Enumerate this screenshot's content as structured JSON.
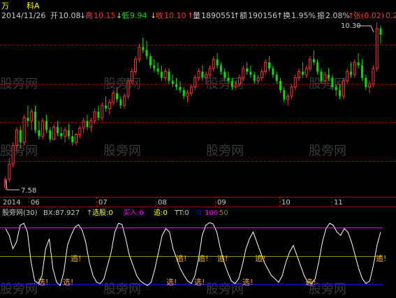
{
  "header": {
    "title": "万",
    "stock_name": "科A",
    "date": "2014/11/26",
    "open_label": "开",
    "open_value": "10.08",
    "high_label": "高",
    "high_value": "10.15",
    "low_label": "低",
    "low_value": "9.94",
    "close_label": "收",
    "close_value": "10.10",
    "volume_label": "量",
    "volume_value": "1890551",
    "amount_label": "额",
    "amount_value": "190156",
    "turnover_label": "换",
    "turnover_value": "1.95%",
    "amplitude_label": "振",
    "amplitude_value": "2.08%",
    "change_label": "张",
    "change_value": "(0.02)",
    "change_pct_value": "0.2"
  },
  "colors": {
    "background": "#000000",
    "up": "#ff3232",
    "down": "#00e000",
    "grid": "#a00000",
    "text": "#c8c8c8",
    "yellow": "#ffff00",
    "magenta": "#ff00ff",
    "indicator_line": "#ffffff",
    "upper_line": "#ff00ff",
    "mid_line": "#909000",
    "lower_line": "#1010ff",
    "signal": "#ffb000"
  },
  "price_labels": {
    "max": "10.30",
    "min": "7.58"
  },
  "watermark": "股旁网",
  "date_axis": [
    "2014",
    "06",
    "07",
    "08",
    "09",
    "10",
    "11"
  ],
  "indicator_header": {
    "name": "股旁网(30)",
    "bx": "BX:87.927",
    "arrow": "↑",
    "select": "选股:0",
    "buy": "买入:0",
    "track": "追:0",
    "tt": "TT:0",
    "l0": "0",
    "l100": "100",
    "l50": "50"
  },
  "signals": {
    "track": "追!",
    "select": "选!"
  },
  "chart_data": {
    "type": "candlestick",
    "x_start": "2014-04",
    "x_end": "2014-11-26",
    "ohlc": [
      [
        7.62,
        7.8,
        7.58,
        7.75
      ],
      [
        7.75,
        8.1,
        7.7,
        8.0
      ],
      [
        8.0,
        8.35,
        7.95,
        8.3
      ],
      [
        8.3,
        8.6,
        8.2,
        8.55
      ],
      [
        8.55,
        8.62,
        8.25,
        8.35
      ],
      [
        8.35,
        8.8,
        8.3,
        8.75
      ],
      [
        8.75,
        8.95,
        8.6,
        8.7
      ],
      [
        8.7,
        8.9,
        8.55,
        8.85
      ],
      [
        8.85,
        8.95,
        8.5,
        8.55
      ],
      [
        8.55,
        8.7,
        8.4,
        8.45
      ],
      [
        8.45,
        8.75,
        8.4,
        8.7
      ],
      [
        8.7,
        8.8,
        8.5,
        8.55
      ],
      [
        8.55,
        8.6,
        8.35,
        8.4
      ],
      [
        8.4,
        8.65,
        8.38,
        8.6
      ],
      [
        8.6,
        8.7,
        8.45,
        8.5
      ],
      [
        8.5,
        8.6,
        8.4,
        8.45
      ],
      [
        8.45,
        8.6,
        8.35,
        8.55
      ],
      [
        8.55,
        8.65,
        8.4,
        8.45
      ],
      [
        8.45,
        8.55,
        8.3,
        8.35
      ],
      [
        8.35,
        8.5,
        8.3,
        8.48
      ],
      [
        8.48,
        8.62,
        8.42,
        8.58
      ],
      [
        8.58,
        8.75,
        8.5,
        8.7
      ],
      [
        8.7,
        8.8,
        8.55,
        8.6
      ],
      [
        8.6,
        8.75,
        8.52,
        8.7
      ],
      [
        8.7,
        8.9,
        8.65,
        8.85
      ],
      [
        8.85,
        8.95,
        8.7,
        8.75
      ],
      [
        8.75,
        9.0,
        8.7,
        8.95
      ],
      [
        8.95,
        9.1,
        8.85,
        8.9
      ],
      [
        8.9,
        9.05,
        8.8,
        9.0
      ],
      [
        9.0,
        9.2,
        8.95,
        9.15
      ],
      [
        9.15,
        9.25,
        9.0,
        9.05
      ],
      [
        9.05,
        9.1,
        8.9,
        8.95
      ],
      [
        8.95,
        9.15,
        8.9,
        9.1
      ],
      [
        9.1,
        9.4,
        9.05,
        9.35
      ],
      [
        9.35,
        9.55,
        9.3,
        9.5
      ],
      [
        9.5,
        9.75,
        9.45,
        9.7
      ],
      [
        9.7,
        9.95,
        9.65,
        9.9
      ],
      [
        9.9,
        10.05,
        9.8,
        9.85
      ],
      [
        9.85,
        10.0,
        9.7,
        9.75
      ],
      [
        9.75,
        9.8,
        9.55,
        9.6
      ],
      [
        9.6,
        9.7,
        9.5,
        9.55
      ],
      [
        9.55,
        9.65,
        9.45,
        9.5
      ],
      [
        9.5,
        9.6,
        9.35,
        9.4
      ],
      [
        9.4,
        9.55,
        9.35,
        9.5
      ],
      [
        9.5,
        9.55,
        9.3,
        9.35
      ],
      [
        9.35,
        9.45,
        9.25,
        9.3
      ],
      [
        9.3,
        9.4,
        9.2,
        9.25
      ],
      [
        9.25,
        9.35,
        9.15,
        9.2
      ],
      [
        9.2,
        9.25,
        9.05,
        9.1
      ],
      [
        9.1,
        9.2,
        9.0,
        9.15
      ],
      [
        9.15,
        9.3,
        9.1,
        9.25
      ],
      [
        9.25,
        9.45,
        9.2,
        9.4
      ],
      [
        9.4,
        9.55,
        9.35,
        9.5
      ],
      [
        9.5,
        9.6,
        9.35,
        9.4
      ],
      [
        9.4,
        9.5,
        9.3,
        9.45
      ],
      [
        9.45,
        9.6,
        9.4,
        9.55
      ],
      [
        9.55,
        9.75,
        9.5,
        9.7
      ],
      [
        9.7,
        9.8,
        9.55,
        9.6
      ],
      [
        9.6,
        9.65,
        9.45,
        9.5
      ],
      [
        9.5,
        9.55,
        9.35,
        9.4
      ],
      [
        9.4,
        9.5,
        9.3,
        9.35
      ],
      [
        9.35,
        9.4,
        9.2,
        9.25
      ],
      [
        9.25,
        9.35,
        9.2,
        9.3
      ],
      [
        9.3,
        9.45,
        9.25,
        9.4
      ],
      [
        9.4,
        9.6,
        9.35,
        9.55
      ],
      [
        9.55,
        9.65,
        9.45,
        9.5
      ],
      [
        9.5,
        9.6,
        9.4,
        9.45
      ],
      [
        9.45,
        9.5,
        9.3,
        9.35
      ],
      [
        9.35,
        9.45,
        9.3,
        9.4
      ],
      [
        9.4,
        9.55,
        9.35,
        9.5
      ],
      [
        9.5,
        9.7,
        9.45,
        9.65
      ],
      [
        9.65,
        9.75,
        9.5,
        9.55
      ],
      [
        9.55,
        9.6,
        9.4,
        9.45
      ],
      [
        9.45,
        9.5,
        9.3,
        9.35
      ],
      [
        9.35,
        9.4,
        9.15,
        9.2
      ],
      [
        9.2,
        9.25,
        9.0,
        9.05
      ],
      [
        9.05,
        9.15,
        8.95,
        9.1
      ],
      [
        9.1,
        9.3,
        9.05,
        9.25
      ],
      [
        9.25,
        9.45,
        9.2,
        9.4
      ],
      [
        9.4,
        9.55,
        9.35,
        9.5
      ],
      [
        9.5,
        9.65,
        9.4,
        9.45
      ],
      [
        9.45,
        9.6,
        9.4,
        9.55
      ],
      [
        9.55,
        9.75,
        9.5,
        9.7
      ],
      [
        9.7,
        9.85,
        9.6,
        9.65
      ],
      [
        9.65,
        9.7,
        9.45,
        9.5
      ],
      [
        9.5,
        9.55,
        9.3,
        9.35
      ],
      [
        9.35,
        9.5,
        9.3,
        9.45
      ],
      [
        9.45,
        9.55,
        9.35,
        9.4
      ],
      [
        9.4,
        9.45,
        9.2,
        9.25
      ],
      [
        9.25,
        9.3,
        9.1,
        9.2
      ],
      [
        9.2,
        9.3,
        9.05,
        9.1
      ],
      [
        9.1,
        9.4,
        9.05,
        9.35
      ],
      [
        9.35,
        9.55,
        9.3,
        9.5
      ],
      [
        9.5,
        9.65,
        9.4,
        9.45
      ],
      [
        9.45,
        9.7,
        9.4,
        9.65
      ],
      [
        9.65,
        9.8,
        9.55,
        9.6
      ],
      [
        9.6,
        9.7,
        9.35,
        9.4
      ],
      [
        9.4,
        9.45,
        9.2,
        9.25
      ],
      [
        9.25,
        9.35,
        9.15,
        9.3
      ],
      [
        9.3,
        9.6,
        9.25,
        9.55
      ],
      [
        9.55,
        10.3,
        9.5,
        10.2
      ],
      [
        10.2,
        10.25,
        9.95,
        10.1
      ]
    ],
    "indicator": {
      "name": "BX",
      "period": 30,
      "values": [
        90,
        80,
        60,
        70,
        95,
        98,
        85,
        40,
        12,
        8,
        20,
        60,
        75,
        30,
        10,
        5,
        25,
        65,
        80,
        92,
        96,
        88,
        70,
        40,
        20,
        10,
        8,
        15,
        35,
        55,
        85,
        98,
        96,
        75,
        50,
        35,
        20,
        12,
        8,
        5,
        10,
        30,
        55,
        80,
        90,
        85,
        60,
        45,
        30,
        20,
        12,
        8,
        20,
        45,
        80,
        95,
        99,
        97,
        85,
        60,
        40,
        25,
        12,
        8,
        15,
        35,
        60,
        75,
        85,
        70,
        55,
        40,
        30,
        20,
        15,
        10,
        20,
        40,
        55,
        65,
        50,
        35,
        20,
        10,
        8,
        15,
        40,
        70,
        90,
        98,
        95,
        85,
        80,
        90,
        85,
        70,
        50,
        30,
        15,
        8,
        12,
        35,
        65,
        85
      ],
      "ylim": [
        0,
        100
      ],
      "levels": [
        0,
        50,
        100
      ]
    },
    "ylim": [
      7.58,
      10.3
    ]
  }
}
